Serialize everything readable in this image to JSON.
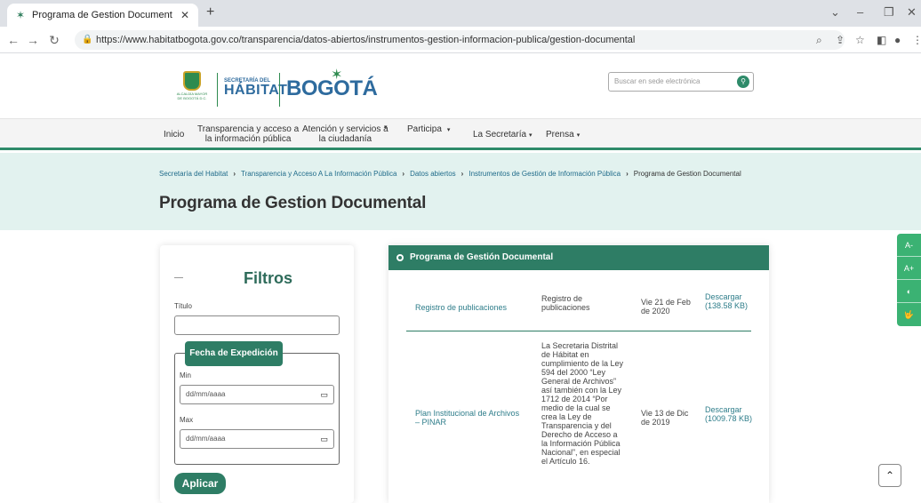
{
  "browser": {
    "tab_title": "Programa de Gestion Document",
    "url": "https://www.habitatbogota.gov.co/transparencia/datos-abiertos/instrumentos-gestion-informacion-publica/gestion-documental"
  },
  "header": {
    "secretaria_small": "SECRETARÍA DEL",
    "secretaria_big": "HÁBITAT",
    "shield_text": "ALCALDÍA MAYOR DE BOGOTÁ D.C.",
    "bogota": "BOGOTÁ",
    "search_placeholder": "Buscar en sede electrónica"
  },
  "nav": {
    "inicio": "Inicio",
    "transparencia_1": "Transparencia y acceso a",
    "transparencia_2": "la información pública",
    "atencion_1": "Atención y servicios a",
    "atencion_2": "la ciudadanía",
    "participa": "Participa",
    "secretaria": "La Secretaría",
    "prensa": "Prensa"
  },
  "breadcrumb": {
    "b1": "Secretaría del Habitat",
    "b2": "Transparencia y Acceso A La Información Pública",
    "b3": "Datos abiertos",
    "b4": "Instrumentos de Gestión de Información Pública",
    "current": "Programa de Gestion Documental"
  },
  "page_title": "Programa de Gestion Documental",
  "filters": {
    "title": "Filtros",
    "titulo_label": "Título",
    "fecha_label": "Fecha de Expedición",
    "min_label": "Min",
    "max_label": "Max",
    "date_placeholder": "dd/mm/aaaa",
    "apply": "Aplicar"
  },
  "results": {
    "header": "Programa de Gestión Documental",
    "rows": [
      {
        "title": "Registro de publicaciones",
        "description": "Registro de publicaciones",
        "date": "Vie 21 de Feb de 2020",
        "download": "Descargar (138.58 KB)"
      },
      {
        "title": "Plan Institucional de Archivos – PINAR",
        "description": "La Secretaria Distrital de Hábitat en cumplimiento de la Ley 594 del 2000 “Ley General de Archivos” así también con la Ley 1712 de 2014 “Por medio de la cual se crea la Ley de Transparencia y del Derecho de Acceso a la Información Pública Nacional”, en especial el Artículo 16.",
        "date": "Vie 13 de Dic de 2019",
        "download": "Descargar (1009.78 KB)"
      }
    ]
  },
  "a11y": {
    "decrease": "A-",
    "increase": "A+",
    "contrast": "◐",
    "sign": "🤟"
  }
}
